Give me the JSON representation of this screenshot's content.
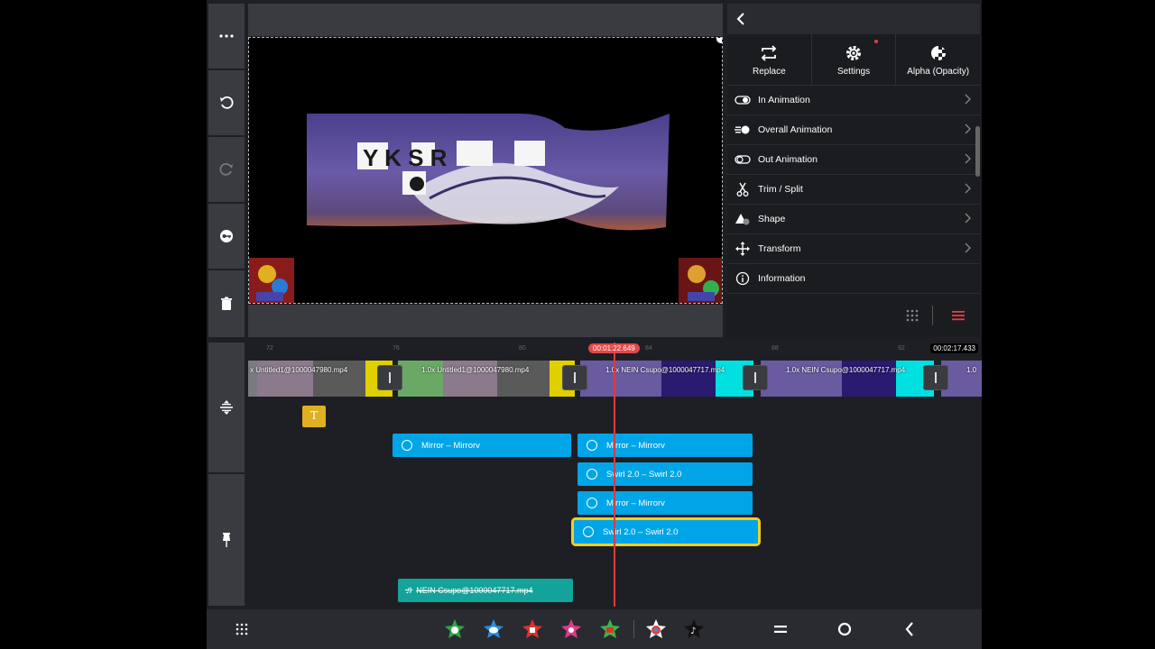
{
  "panel": {
    "tabs": [
      {
        "label": "Replace",
        "icon": "replace-icon"
      },
      {
        "label": "Settings",
        "icon": "gear-icon"
      },
      {
        "label": "Alpha (Opacity)",
        "icon": "checkerboard-icon"
      }
    ],
    "rows": [
      {
        "label": "In Animation",
        "icon": "toggle-in-icon"
      },
      {
        "label": "Overall Animation",
        "icon": "overall-animation-icon"
      },
      {
        "label": "Out Animation",
        "icon": "toggle-out-icon"
      },
      {
        "label": "Trim / Split",
        "icon": "scissors-icon"
      },
      {
        "label": "Shape",
        "icon": "shape-icon"
      },
      {
        "label": "Transform",
        "icon": "move-icon"
      },
      {
        "label": "Information",
        "icon": "info-icon"
      }
    ]
  },
  "timeline": {
    "playhead_time": "00:01:22.649",
    "end_time": "00:02:17.433",
    "ruler_labels": [
      "72",
      "76",
      "80",
      "84",
      "88",
      "92"
    ],
    "clips": [
      {
        "label": "x Untitled1@1000047980.mp4"
      },
      {
        "label": "1.0x Untitled1@1000047980.mp4"
      },
      {
        "label": "1.0x NEIN Csupo@1000047717.mp4"
      },
      {
        "label": "1.0x NEIN Csupo@1000047717.mp4"
      },
      {
        "label": "1.0"
      }
    ],
    "text_layer_label": "T",
    "effects": [
      {
        "label": "Mirror – Mirrorv"
      },
      {
        "label": "Mirror – Mirrorv"
      },
      {
        "label": "Swirl 2.0 – Swirl 2.0"
      },
      {
        "label": "Mirror – Mirrorv"
      },
      {
        "label": "Swirl 2.0 – Swirl 2.0"
      }
    ],
    "audio_label": "NEIN Csupo@1000047717.mp4"
  },
  "preview": {
    "video_text": "Y K S R"
  },
  "colors": {
    "accent": "#00a5e8",
    "selection": "#f2d024",
    "playhead": "#e03a3a",
    "audio": "#13a39b"
  }
}
